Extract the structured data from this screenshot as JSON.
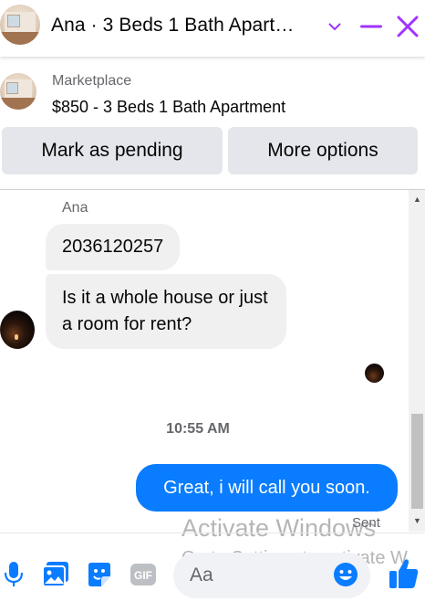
{
  "header": {
    "title": "Ana · 3 Beds 1 Bath Apart…",
    "avatar_icon": "listing-photo",
    "accent": "#a033ff"
  },
  "listing": {
    "label": "Marketplace",
    "title": "$850 - 3 Beds 1 Bath Apartment",
    "pending_button": "Mark as pending",
    "more_button": "More options"
  },
  "thread": {
    "sender": "Ana",
    "messages_in": [
      "2036120257",
      "Is it a whole house or just a room for rent?"
    ],
    "timestamp": "10:55 AM",
    "message_out": "Great, i will call you soon.",
    "status": "Sent",
    "outgoing_color": "#0a7cff"
  },
  "watermark": {
    "line1": "Activate Windows",
    "line2": "Go to Settings to activate W"
  },
  "composer": {
    "placeholder": "Aa",
    "tools": [
      "microphone-icon",
      "photo-icon",
      "sticker-icon",
      "gif-icon"
    ],
    "gif_label": "GIF",
    "brand_color": "#0a7cff"
  }
}
